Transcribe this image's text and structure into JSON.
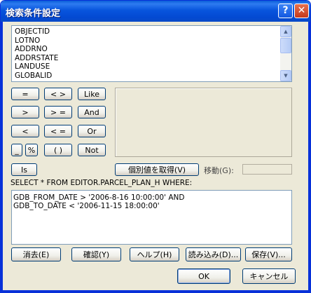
{
  "window": {
    "title": "検索条件設定"
  },
  "titlebar": {
    "help_glyph": "?",
    "close_glyph": "✕"
  },
  "fields": [
    "OBJECTID",
    "LOTNO",
    "ADDRNO",
    "ADDRSTATE",
    "LANDUSE",
    "GLOBALID"
  ],
  "scroll": {
    "up_glyph": "▲",
    "down_glyph": "▼"
  },
  "operators": {
    "eq": "=",
    "ne": "< >",
    "like": "Like",
    "gt": ">",
    "ge": "> =",
    "and": "And",
    "lt": "<",
    "le": "< =",
    "or": "Or",
    "underscore": "_",
    "percent": "%",
    "parens": "( )",
    "not": "Not",
    "is": "Is"
  },
  "unique_values_button": "個別値を取得(V)",
  "move_label": "移動(G):",
  "move_value": "",
  "where_label": "SELECT * FROM EDITOR.PARCEL_PLAN_H WHERE:",
  "query_lines": [
    "GDB_FROM_DATE > '2006-8-16 10:00:00'  AND",
    " GDB_TO_DATE < '2006-11-15 18:00:00'"
  ],
  "actions": {
    "clear": "消去(E)",
    "verify": "確認(Y)",
    "help": "ヘルプ(H)",
    "load": "読み込み(D)...",
    "save": "保存(V)..."
  },
  "dialog": {
    "ok": "OK",
    "cancel": "キャンセル"
  },
  "colors": {
    "titlebar": "#0855dd",
    "face": "#ece9d8",
    "border": "#0831d9",
    "close": "#c4391c"
  }
}
